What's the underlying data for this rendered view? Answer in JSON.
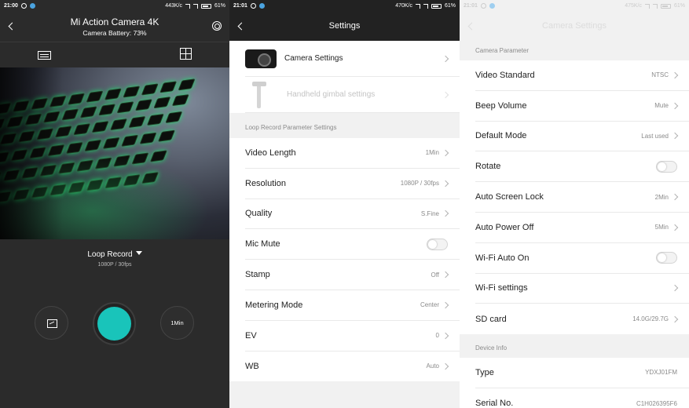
{
  "panel1": {
    "status": {
      "time": "21:00",
      "speed": "443K/c",
      "battery": "61%"
    },
    "title": "Mi Action Camera 4K",
    "subtitle": "Camera Battery: 73%",
    "mode_label": "Loop Record",
    "mode_sub": "1080P / 30fps",
    "timer_label": "1Min",
    "icons": [
      "back-chevron-icon",
      "settings-gear-icon",
      "landscape-view-icon",
      "grid-view-icon",
      "gallery-icon"
    ],
    "accent_color": "#19c4ba"
  },
  "panel2": {
    "status": {
      "time": "21:01",
      "speed": "470K/c",
      "battery": "61%"
    },
    "title": "Settings",
    "devices": [
      {
        "label": "Camera Settings",
        "enabled": true
      },
      {
        "label": "Handheld gimbal settings",
        "enabled": false
      }
    ],
    "section_label": "Loop Record  Parameter Settings",
    "rows": [
      {
        "label": "Video Length",
        "value": "1Min",
        "type": "chevron"
      },
      {
        "label": "Resolution",
        "value": "1080P / 30fps",
        "type": "chevron"
      },
      {
        "label": "Quality",
        "value": "S.Fine",
        "type": "chevron"
      },
      {
        "label": "Mic Mute",
        "value": "",
        "type": "toggle"
      },
      {
        "label": "Stamp",
        "value": "Off",
        "type": "chevron"
      },
      {
        "label": "Metering Mode",
        "value": "Center",
        "type": "chevron"
      },
      {
        "label": "EV",
        "value": "0",
        "type": "chevron"
      },
      {
        "label": "WB",
        "value": "Auto",
        "type": "chevron"
      }
    ]
  },
  "panel3": {
    "status": {
      "time": "21:01",
      "speed": "475K/c",
      "battery": "61%"
    },
    "title": "Camera Settings",
    "section_camera": "Camera Parameter",
    "rows": [
      {
        "label": "Video Standard",
        "value": "NTSC",
        "type": "chevron"
      },
      {
        "label": "Beep Volume",
        "value": "Mute",
        "type": "chevron"
      },
      {
        "label": "Default Mode",
        "value": "Last used",
        "type": "chevron"
      },
      {
        "label": "Rotate",
        "value": "",
        "type": "toggle"
      },
      {
        "label": "Auto Screen Lock",
        "value": "2Min",
        "type": "chevron"
      },
      {
        "label": "Auto Power Off",
        "value": "5Min",
        "type": "chevron"
      },
      {
        "label": "Wi-Fi Auto On",
        "value": "",
        "type": "toggle"
      },
      {
        "label": "Wi-Fi settings",
        "value": "",
        "type": "chevron"
      },
      {
        "label": "SD card",
        "value": "14.0G/29.7G",
        "type": "chevron"
      }
    ],
    "section_device": "Device Info",
    "info_rows": [
      {
        "label": "Type",
        "value": "YDXJ01FM"
      },
      {
        "label": "Serial No.",
        "value": "C1H026395F6"
      }
    ]
  }
}
